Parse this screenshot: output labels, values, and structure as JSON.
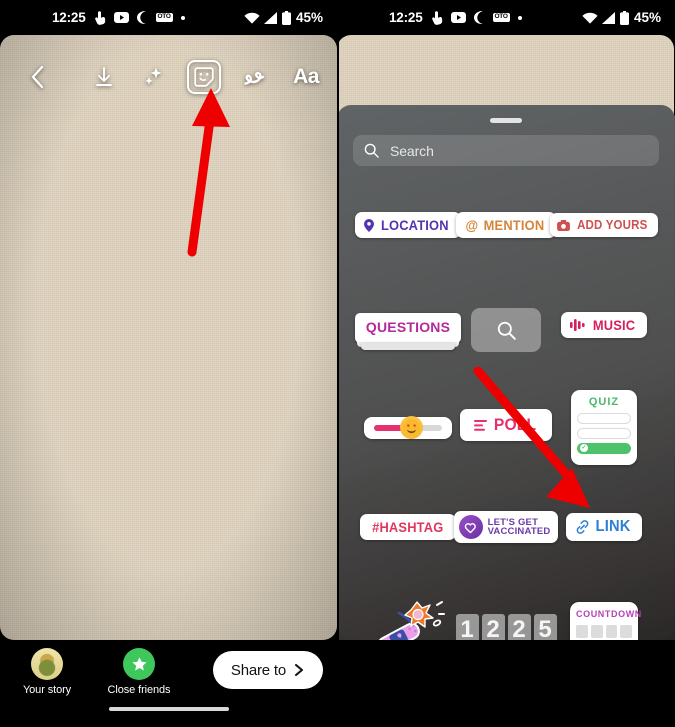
{
  "status_bar": {
    "time": "12:25",
    "icons": [
      "touch-icon",
      "youtube-icon",
      "moon-icon",
      "oto-badge-icon",
      "dot-icon"
    ],
    "oto_badge": "OTO",
    "wifi": "wifi-icon",
    "signal": "signal-icon",
    "battery_percent": "45%"
  },
  "left_phone": {
    "toolbar": {
      "back": "back-chevron",
      "download": "download-icon",
      "sparkle": "sparkle-icon",
      "sticker": "sticker-smiley-icon",
      "draw": "draw-squiggle-icon",
      "text": "Aa"
    },
    "bottom": {
      "your_story_label": "Your story",
      "close_friends_label": "Close friends",
      "share_label": "Share to"
    }
  },
  "right_phone": {
    "tray": {
      "search_placeholder": "Search",
      "rows": [
        [
          {
            "id": "location",
            "label": "LOCATION",
            "kind": "chip",
            "icon": "pin-icon",
            "color": "#5433b0"
          },
          {
            "id": "mention",
            "label": "MENTION",
            "kind": "chip",
            "icon": "at-icon",
            "color": "#d68438"
          },
          {
            "id": "add-yours",
            "label": "ADD YOURS",
            "kind": "chip",
            "icon": "camera-icon",
            "color": "#cf5050"
          }
        ],
        [
          {
            "id": "questions",
            "label": "QUESTIONS",
            "kind": "questions",
            "color": "#b52a9b"
          },
          {
            "id": "gif-search",
            "label": "",
            "kind": "search-tile",
            "icon": "search-icon"
          },
          {
            "id": "music",
            "label": "MUSIC",
            "kind": "chip",
            "icon": "music-bars-icon",
            "color": "#d6205c"
          }
        ],
        [
          {
            "id": "emoji-slider",
            "label": "",
            "kind": "slider",
            "emoji": "smiley-hearts-emoji",
            "color": "#e6316d"
          },
          {
            "id": "poll",
            "label": "POLL",
            "kind": "chip",
            "icon": "poll-lines-icon",
            "color": "#e6316d"
          },
          {
            "id": "quiz",
            "label": "QUIZ",
            "kind": "quiz",
            "color": "#49b96a"
          }
        ],
        [
          {
            "id": "hashtag",
            "label": "#HASHTAG",
            "kind": "chip",
            "color": "#e0365f"
          },
          {
            "id": "vaccinated",
            "label": "LET'S GET VACCINATED",
            "label_line1": "LET'S GET",
            "label_line2": "VACCINATED",
            "kind": "vaccinated",
            "color": "#6b3ba8"
          },
          {
            "id": "link",
            "label": "LINK",
            "kind": "chip",
            "icon": "link-icon",
            "color": "#2f7fd6"
          }
        ],
        [
          {
            "id": "flower-bandaid",
            "label": "",
            "kind": "art-sticker"
          },
          {
            "id": "clock",
            "label": "12 25",
            "kind": "clock",
            "digits": [
              "1",
              "2",
              "2",
              "5"
            ]
          },
          {
            "id": "countdown",
            "label": "COUNTDOWN",
            "kind": "countdown",
            "color": "#b93fb8"
          }
        ]
      ]
    }
  },
  "annotations": {
    "left_arrow": {
      "name": "red-arrow-to-sticker-button",
      "color": "#ef0000"
    },
    "right_arrow": {
      "name": "red-arrow-to-link-sticker",
      "color": "#ef0000"
    }
  }
}
